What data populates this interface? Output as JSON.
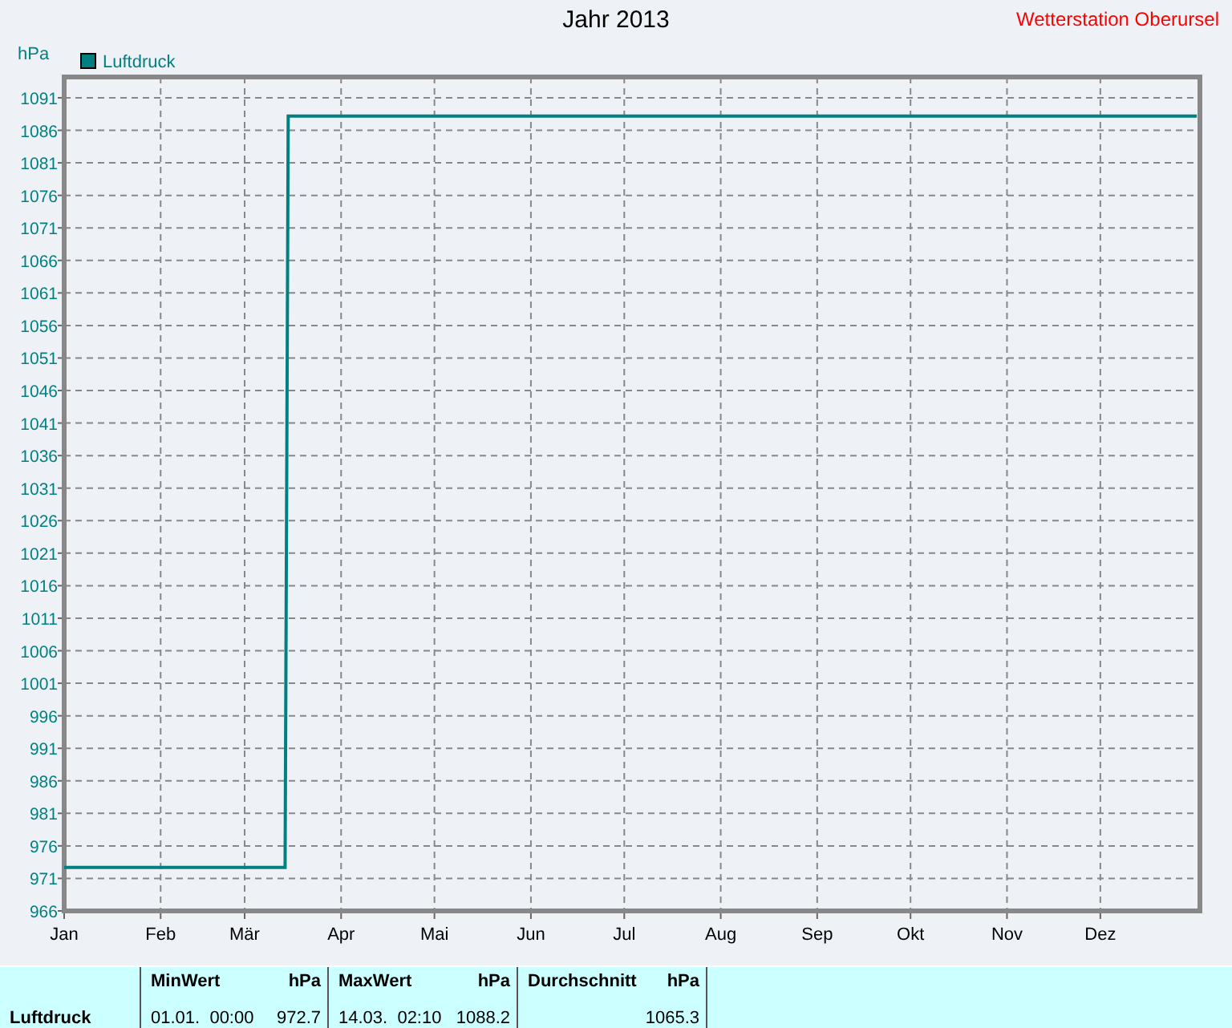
{
  "station": "Wetterstation Oberursel",
  "chart": {
    "chart_data": {
      "type": "line",
      "title": "Jahr 2013",
      "ylabel": "hPa",
      "grid": true,
      "categories": [
        "Jan",
        null,
        null,
        null,
        null,
        null,
        null,
        null,
        null,
        null,
        null,
        null,
        null,
        null,
        null,
        null,
        null,
        null,
        null,
        null,
        null,
        null,
        null,
        null,
        null,
        null,
        null,
        null,
        null,
        null,
        null,
        "Feb",
        null,
        null,
        null,
        null,
        null,
        null,
        null,
        null,
        null,
        null,
        null,
        null,
        null,
        null,
        null,
        null,
        null,
        null,
        null,
        null,
        null,
        null,
        null,
        null,
        null,
        null,
        "Mär",
        null,
        null,
        null,
        null,
        null,
        null,
        null,
        null,
        null,
        null,
        null,
        null,
        null,
        null,
        null,
        null,
        null,
        null,
        null,
        null,
        null,
        null,
        null,
        null,
        null,
        null,
        null,
        null,
        null,
        null,
        "Apr",
        null,
        null,
        null,
        null,
        null,
        null,
        null,
        null,
        null,
        null,
        null,
        null,
        null,
        null,
        null,
        null,
        null,
        null,
        null,
        null,
        null,
        null,
        null,
        null,
        null,
        null,
        null,
        null,
        null,
        "Mai",
        null,
        null,
        null,
        null,
        null,
        null,
        null,
        null,
        null,
        null,
        null,
        null,
        null,
        null,
        null,
        null,
        null,
        null,
        null,
        null,
        null,
        null,
        null,
        null,
        null,
        null,
        null,
        null,
        null,
        null,
        "Jun",
        null,
        null,
        null,
        null,
        null,
        null,
        null,
        null,
        null,
        null,
        null,
        null,
        null,
        null,
        null,
        null,
        null,
        null,
        null,
        null,
        null,
        null,
        null,
        null,
        null,
        null,
        null,
        null,
        null,
        "Jul",
        null,
        null,
        null,
        null,
        null,
        null,
        null,
        null,
        null,
        null,
        null,
        null,
        null,
        null,
        null,
        null,
        null,
        null,
        null,
        null,
        null,
        null,
        null,
        null,
        null,
        null,
        null,
        null,
        null,
        null,
        "Aug",
        null,
        null,
        null,
        null,
        null,
        null,
        null,
        null,
        null,
        null,
        null,
        null,
        null,
        null,
        null,
        null,
        null,
        null,
        null,
        null,
        null,
        null,
        null,
        null,
        null,
        null,
        null,
        null,
        null,
        null,
        "Sep",
        null,
        null,
        null,
        null,
        null,
        null,
        null,
        null,
        null,
        null,
        null,
        null,
        null,
        null,
        null,
        null,
        null,
        null,
        null,
        null,
        null,
        null,
        null,
        null,
        null,
        null,
        null,
        null,
        null,
        "Okt",
        null,
        null,
        null,
        null,
        null,
        null,
        null,
        null,
        null,
        null,
        null,
        null,
        null,
        null,
        null,
        null,
        null,
        null,
        null,
        null,
        null,
        null,
        null,
        null,
        null,
        null,
        null,
        null,
        null,
        null,
        "Nov",
        null,
        null,
        null,
        null,
        null,
        null,
        null,
        null,
        null,
        null,
        null,
        null,
        null,
        null,
        null,
        null,
        null,
        null,
        null,
        null,
        null,
        null,
        null,
        null,
        null,
        null,
        null,
        null,
        null,
        "Dez",
        null,
        null,
        null,
        null,
        null,
        null,
        null,
        null,
        null,
        null,
        null,
        null,
        null,
        null,
        null,
        null,
        null,
        null,
        null,
        null,
        null,
        null,
        null,
        null,
        null,
        null,
        null,
        null,
        null,
        null,
        null
      ],
      "series": [
        {
          "name": "Luftdruck",
          "color": "#008080",
          "values": [
            972.7,
            972.7,
            972.7,
            972.7,
            972.7,
            972.7,
            972.7,
            972.7,
            972.7,
            972.7,
            972.7,
            972.7,
            972.7,
            972.7,
            972.7,
            972.7,
            972.7,
            972.7,
            972.7,
            972.7,
            972.7,
            972.7,
            972.7,
            972.7,
            972.7,
            972.7,
            972.7,
            972.7,
            972.7,
            972.7,
            972.7,
            972.7,
            972.7,
            972.7,
            972.7,
            972.7,
            972.7,
            972.7,
            972.7,
            972.7,
            972.7,
            972.7,
            972.7,
            972.7,
            972.7,
            972.7,
            972.7,
            972.7,
            972.7,
            972.7,
            972.7,
            972.7,
            972.7,
            972.7,
            972.7,
            972.7,
            972.7,
            972.7,
            972.7,
            972.7,
            972.7,
            972.7,
            972.7,
            972.7,
            972.7,
            972.7,
            972.7,
            972.7,
            972.7,
            972.7,
            972.7,
            972.7,
            1088.2,
            1088.2,
            1088.2,
            1088.2,
            1088.2,
            1088.2,
            1088.2,
            1088.2,
            1088.2,
            1088.2,
            1088.2,
            1088.2,
            1088.2,
            1088.2,
            1088.2,
            1088.2,
            1088.2,
            1088.2,
            1088.2,
            1088.2,
            1088.2,
            1088.2,
            1088.2,
            1088.2,
            1088.2,
            1088.2,
            1088.2,
            1088.2,
            1088.2,
            1088.2,
            1088.2,
            1088.2,
            1088.2,
            1088.2,
            1088.2,
            1088.2,
            1088.2,
            1088.2,
            1088.2,
            1088.2,
            1088.2,
            1088.2,
            1088.2,
            1088.2,
            1088.2,
            1088.2,
            1088.2,
            1088.2,
            1088.2,
            1088.2,
            1088.2,
            1088.2,
            1088.2,
            1088.2,
            1088.2,
            1088.2,
            1088.2,
            1088.2,
            1088.2,
            1088.2,
            1088.2,
            1088.2,
            1088.2,
            1088.2,
            1088.2,
            1088.2,
            1088.2,
            1088.2,
            1088.2,
            1088.2,
            1088.2,
            1088.2,
            1088.2,
            1088.2,
            1088.2,
            1088.2,
            1088.2,
            1088.2,
            1088.2,
            1088.2,
            1088.2,
            1088.2,
            1088.2,
            1088.2,
            1088.2,
            1088.2,
            1088.2,
            1088.2,
            1088.2,
            1088.2,
            1088.2,
            1088.2,
            1088.2,
            1088.2,
            1088.2,
            1088.2,
            1088.2,
            1088.2,
            1088.2,
            1088.2,
            1088.2,
            1088.2,
            1088.2,
            1088.2,
            1088.2,
            1088.2,
            1088.2,
            1088.2,
            1088.2,
            1088.2,
            1088.2,
            1088.2,
            1088.2,
            1088.2,
            1088.2,
            1088.2,
            1088.2,
            1088.2,
            1088.2,
            1088.2,
            1088.2,
            1088.2,
            1088.2,
            1088.2,
            1088.2,
            1088.2,
            1088.2,
            1088.2,
            1088.2,
            1088.2,
            1088.2,
            1088.2,
            1088.2,
            1088.2,
            1088.2,
            1088.2,
            1088.2,
            1088.2,
            1088.2,
            1088.2,
            1088.2,
            1088.2,
            1088.2,
            1088.2,
            1088.2,
            1088.2,
            1088.2,
            1088.2,
            1088.2,
            1088.2,
            1088.2,
            1088.2,
            1088.2,
            1088.2,
            1088.2,
            1088.2,
            1088.2,
            1088.2,
            1088.2,
            1088.2,
            1088.2,
            1088.2,
            1088.2,
            1088.2,
            1088.2,
            1088.2,
            1088.2,
            1088.2,
            1088.2,
            1088.2,
            1088.2,
            1088.2,
            1088.2,
            1088.2,
            1088.2,
            1088.2,
            1088.2,
            1088.2,
            1088.2,
            1088.2,
            1088.2,
            1088.2,
            1088.2,
            1088.2,
            1088.2,
            1088.2,
            1088.2,
            1088.2,
            1088.2,
            1088.2,
            1088.2,
            1088.2,
            1088.2,
            1088.2,
            1088.2,
            1088.2,
            1088.2,
            1088.2,
            1088.2,
            1088.2,
            1088.2,
            1088.2,
            1088.2,
            1088.2,
            1088.2,
            1088.2,
            1088.2,
            1088.2,
            1088.2,
            1088.2,
            1088.2,
            1088.2,
            1088.2,
            1088.2,
            1088.2,
            1088.2,
            1088.2,
            1088.2,
            1088.2,
            1088.2,
            1088.2,
            1088.2,
            1088.2,
            1088.2,
            1088.2,
            1088.2,
            1088.2,
            1088.2,
            1088.2,
            1088.2,
            1088.2,
            1088.2,
            1088.2,
            1088.2,
            1088.2,
            1088.2,
            1088.2,
            1088.2,
            1088.2,
            1088.2,
            1088.2,
            1088.2,
            1088.2,
            1088.2,
            1088.2,
            1088.2,
            1088.2,
            1088.2,
            1088.2,
            1088.2,
            1088.2,
            1088.2,
            1088.2,
            1088.2,
            1088.2,
            1088.2,
            1088.2,
            1088.2,
            1088.2,
            1088.2,
            1088.2,
            1088.2,
            1088.2,
            1088.2,
            1088.2,
            1088.2,
            1088.2,
            1088.2,
            1088.2,
            1088.2,
            1088.2,
            1088.2,
            1088.2,
            1088.2,
            1088.2,
            1088.2,
            1088.2,
            1088.2,
            1088.2,
            1088.2,
            1088.2,
            1088.2,
            1088.2,
            1088.2,
            1088.2,
            1088.2,
            1088.2,
            1088.2,
            1088.2,
            1088.2,
            1088.2,
            1088.2,
            1088.2
          ]
        }
      ],
      "ylim": [
        966,
        1094.2
      ],
      "yticks": [
        966,
        971,
        976,
        981,
        986,
        991,
        996,
        1001,
        1006,
        1011,
        1016,
        1021,
        1026,
        1031,
        1036,
        1041,
        1046,
        1051,
        1056,
        1061,
        1066,
        1071,
        1076,
        1081,
        1086,
        1091
      ]
    }
  },
  "stats": {
    "row_label": "Luftdruck",
    "columns": [
      {
        "header": "MinWert",
        "unit": "hPa",
        "time": "01.01.  00:00",
        "value": "972.7"
      },
      {
        "header": "MaxWert",
        "unit": "hPa",
        "time": "14.03.  02:10",
        "value": "1088.2"
      },
      {
        "header": "Durchschnitt",
        "unit": "hPa",
        "value": "1065.3"
      }
    ]
  }
}
